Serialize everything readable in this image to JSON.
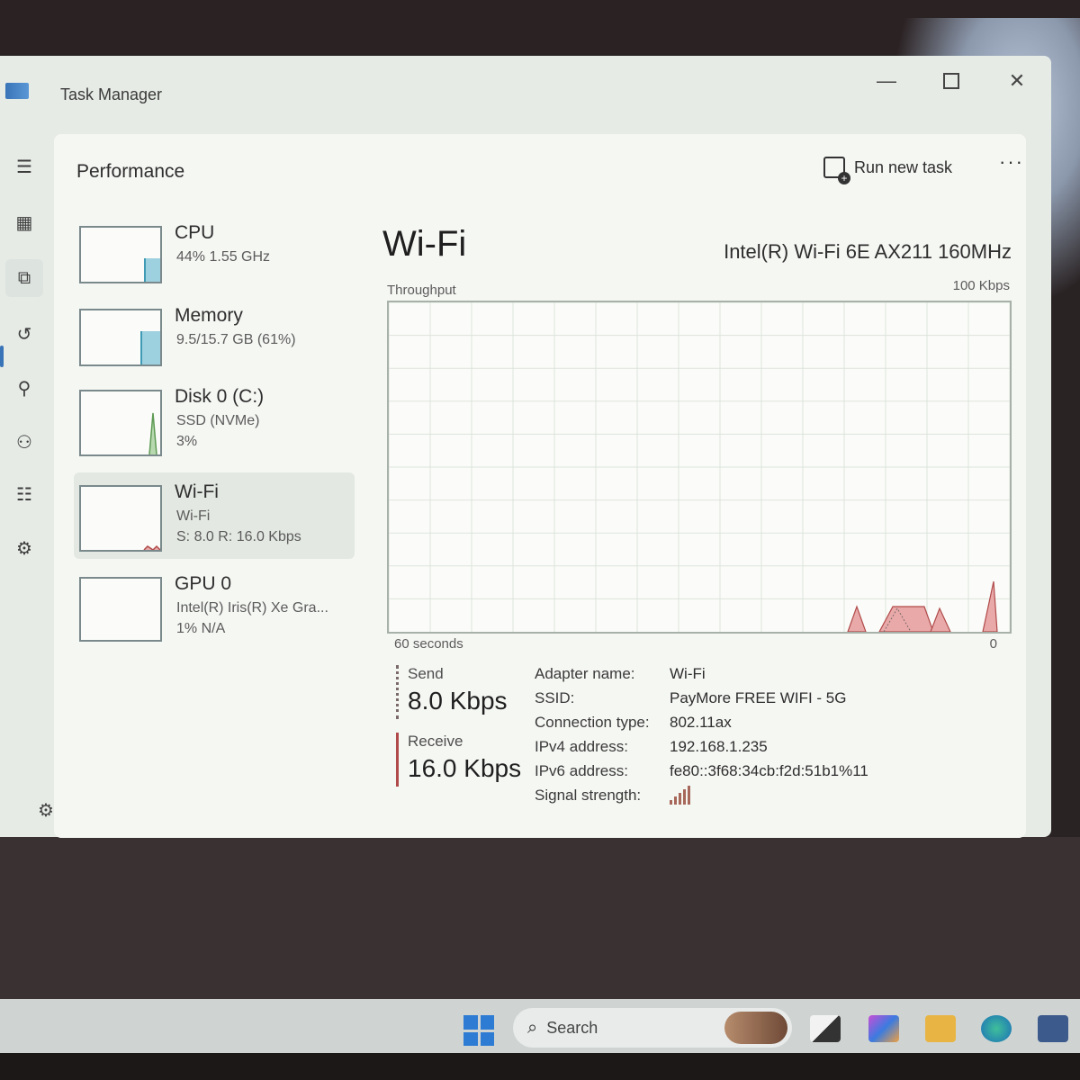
{
  "window": {
    "title": "Task Manager",
    "controls": {
      "minimize": "—",
      "maximize": "",
      "close": "✕"
    }
  },
  "nav": {
    "items": [
      {
        "name": "hamburger-icon",
        "glyph": "☰"
      },
      {
        "name": "processes-icon",
        "glyph": "▦"
      },
      {
        "name": "performance-icon",
        "glyph": "⧉"
      },
      {
        "name": "app-history-icon",
        "glyph": "↺"
      },
      {
        "name": "startup-apps-icon",
        "glyph": "⚲"
      },
      {
        "name": "users-icon",
        "glyph": "⚇"
      },
      {
        "name": "details-icon",
        "glyph": "☷"
      },
      {
        "name": "services-icon",
        "glyph": "⚙"
      }
    ],
    "settings_glyph": "⚙"
  },
  "header": {
    "title": "Performance",
    "run_new_task": "Run new task",
    "more": "···"
  },
  "devices": [
    {
      "name": "CPU",
      "line1": "44%  1.55 GHz",
      "line2": "",
      "fill": 0.44
    },
    {
      "name": "Memory",
      "line1": "9.5/15.7 GB (61%)",
      "line2": "",
      "fill": 0.61
    },
    {
      "name": "Disk 0 (C:)",
      "line1": "SSD (NVMe)",
      "line2": "3%",
      "fill": 0.03
    },
    {
      "name": "Wi-Fi",
      "line1": "Wi-Fi",
      "line2": "S: 8.0  R: 16.0 Kbps",
      "fill": 0.05
    },
    {
      "name": "GPU 0",
      "line1": "Intel(R) Iris(R) Xe Gra...",
      "line2": "1%  N/A",
      "fill": 0.01
    }
  ],
  "detail": {
    "title": "Wi-Fi",
    "model": "Intel(R) Wi-Fi 6E AX211 160MHz",
    "chart_label": "Throughput",
    "chart_max": "100 Kbps",
    "x_left": "60 seconds",
    "x_right": "0",
    "send_label": "Send",
    "send_value": "8.0 Kbps",
    "receive_label": "Receive",
    "receive_value": "16.0 Kbps",
    "props": [
      {
        "key": "Adapter name:",
        "value": "Wi-Fi"
      },
      {
        "key": "SSID:",
        "value": "PayMore FREE WIFI - 5G"
      },
      {
        "key": "Connection type:",
        "value": "802.11ax"
      },
      {
        "key": "IPv4 address:",
        "value": "192.168.1.235"
      },
      {
        "key": "IPv6 address:",
        "value": "fe80::3f68:34cb:f2d:51b1%11"
      },
      {
        "key": "Signal strength:",
        "value": ""
      }
    ],
    "signal_bars": 5
  },
  "taskbar": {
    "search_label": "Search"
  },
  "colors": {
    "accent": "#3a74b8",
    "receive_line": "#b04a4a",
    "chart_fill": "#e9a9a9"
  }
}
